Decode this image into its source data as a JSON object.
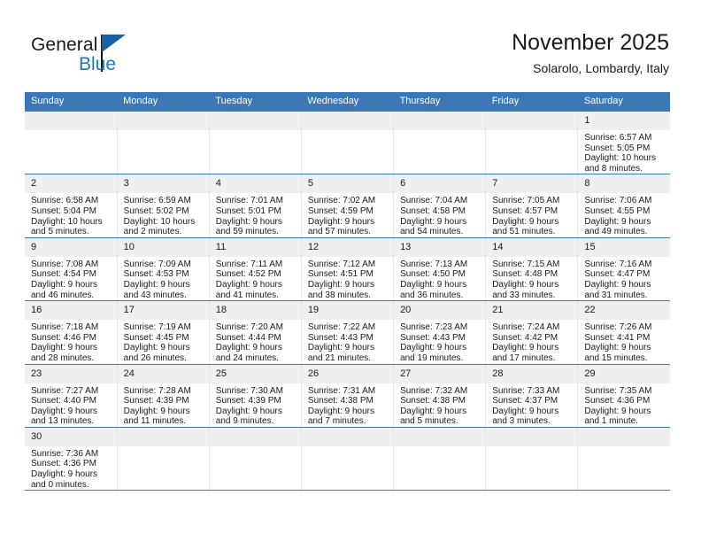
{
  "brand": {
    "name_top": "General",
    "name_bottom": "Blue",
    "triangle_color": "#1463a8",
    "blue_text_color": "#1878c8"
  },
  "header": {
    "title": "November 2025",
    "subtitle": "Solarolo, Lombardy, Italy"
  },
  "theme": {
    "header_blue": "#3b78b5",
    "daynum_bg": "#efefef",
    "row_divider": "#3b78b5"
  },
  "calendar": {
    "weekday_headers": [
      "Sunday",
      "Monday",
      "Tuesday",
      "Wednesday",
      "Thursday",
      "Friday",
      "Saturday"
    ],
    "labels": {
      "sunrise": "Sunrise:",
      "sunset": "Sunset:",
      "daylight": "Daylight:"
    },
    "weeks": [
      [
        {
          "day": "",
          "blank": true
        },
        {
          "day": "",
          "blank": true
        },
        {
          "day": "",
          "blank": true
        },
        {
          "day": "",
          "blank": true
        },
        {
          "day": "",
          "blank": true
        },
        {
          "day": "",
          "blank": true
        },
        {
          "day": "1",
          "sunrise": "Sunrise: 6:57 AM",
          "sunset": "Sunset: 5:05 PM",
          "daylight1": "Daylight: 10 hours",
          "daylight2": "and 8 minutes."
        }
      ],
      [
        {
          "day": "2",
          "sunrise": "Sunrise: 6:58 AM",
          "sunset": "Sunset: 5:04 PM",
          "daylight1": "Daylight: 10 hours",
          "daylight2": "and 5 minutes."
        },
        {
          "day": "3",
          "sunrise": "Sunrise: 6:59 AM",
          "sunset": "Sunset: 5:02 PM",
          "daylight1": "Daylight: 10 hours",
          "daylight2": "and 2 minutes."
        },
        {
          "day": "4",
          "sunrise": "Sunrise: 7:01 AM",
          "sunset": "Sunset: 5:01 PM",
          "daylight1": "Daylight: 9 hours",
          "daylight2": "and 59 minutes."
        },
        {
          "day": "5",
          "sunrise": "Sunrise: 7:02 AM",
          "sunset": "Sunset: 4:59 PM",
          "daylight1": "Daylight: 9 hours",
          "daylight2": "and 57 minutes."
        },
        {
          "day": "6",
          "sunrise": "Sunrise: 7:04 AM",
          "sunset": "Sunset: 4:58 PM",
          "daylight1": "Daylight: 9 hours",
          "daylight2": "and 54 minutes."
        },
        {
          "day": "7",
          "sunrise": "Sunrise: 7:05 AM",
          "sunset": "Sunset: 4:57 PM",
          "daylight1": "Daylight: 9 hours",
          "daylight2": "and 51 minutes."
        },
        {
          "day": "8",
          "sunrise": "Sunrise: 7:06 AM",
          "sunset": "Sunset: 4:55 PM",
          "daylight1": "Daylight: 9 hours",
          "daylight2": "and 49 minutes."
        }
      ],
      [
        {
          "day": "9",
          "sunrise": "Sunrise: 7:08 AM",
          "sunset": "Sunset: 4:54 PM",
          "daylight1": "Daylight: 9 hours",
          "daylight2": "and 46 minutes."
        },
        {
          "day": "10",
          "sunrise": "Sunrise: 7:09 AM",
          "sunset": "Sunset: 4:53 PM",
          "daylight1": "Daylight: 9 hours",
          "daylight2": "and 43 minutes."
        },
        {
          "day": "11",
          "sunrise": "Sunrise: 7:11 AM",
          "sunset": "Sunset: 4:52 PM",
          "daylight1": "Daylight: 9 hours",
          "daylight2": "and 41 minutes."
        },
        {
          "day": "12",
          "sunrise": "Sunrise: 7:12 AM",
          "sunset": "Sunset: 4:51 PM",
          "daylight1": "Daylight: 9 hours",
          "daylight2": "and 38 minutes."
        },
        {
          "day": "13",
          "sunrise": "Sunrise: 7:13 AM",
          "sunset": "Sunset: 4:50 PM",
          "daylight1": "Daylight: 9 hours",
          "daylight2": "and 36 minutes."
        },
        {
          "day": "14",
          "sunrise": "Sunrise: 7:15 AM",
          "sunset": "Sunset: 4:48 PM",
          "daylight1": "Daylight: 9 hours",
          "daylight2": "and 33 minutes."
        },
        {
          "day": "15",
          "sunrise": "Sunrise: 7:16 AM",
          "sunset": "Sunset: 4:47 PM",
          "daylight1": "Daylight: 9 hours",
          "daylight2": "and 31 minutes."
        }
      ],
      [
        {
          "day": "16",
          "sunrise": "Sunrise: 7:18 AM",
          "sunset": "Sunset: 4:46 PM",
          "daylight1": "Daylight: 9 hours",
          "daylight2": "and 28 minutes."
        },
        {
          "day": "17",
          "sunrise": "Sunrise: 7:19 AM",
          "sunset": "Sunset: 4:45 PM",
          "daylight1": "Daylight: 9 hours",
          "daylight2": "and 26 minutes."
        },
        {
          "day": "18",
          "sunrise": "Sunrise: 7:20 AM",
          "sunset": "Sunset: 4:44 PM",
          "daylight1": "Daylight: 9 hours",
          "daylight2": "and 24 minutes."
        },
        {
          "day": "19",
          "sunrise": "Sunrise: 7:22 AM",
          "sunset": "Sunset: 4:43 PM",
          "daylight1": "Daylight: 9 hours",
          "daylight2": "and 21 minutes."
        },
        {
          "day": "20",
          "sunrise": "Sunrise: 7:23 AM",
          "sunset": "Sunset: 4:43 PM",
          "daylight1": "Daylight: 9 hours",
          "daylight2": "and 19 minutes."
        },
        {
          "day": "21",
          "sunrise": "Sunrise: 7:24 AM",
          "sunset": "Sunset: 4:42 PM",
          "daylight1": "Daylight: 9 hours",
          "daylight2": "and 17 minutes."
        },
        {
          "day": "22",
          "sunrise": "Sunrise: 7:26 AM",
          "sunset": "Sunset: 4:41 PM",
          "daylight1": "Daylight: 9 hours",
          "daylight2": "and 15 minutes."
        }
      ],
      [
        {
          "day": "23",
          "sunrise": "Sunrise: 7:27 AM",
          "sunset": "Sunset: 4:40 PM",
          "daylight1": "Daylight: 9 hours",
          "daylight2": "and 13 minutes."
        },
        {
          "day": "24",
          "sunrise": "Sunrise: 7:28 AM",
          "sunset": "Sunset: 4:39 PM",
          "daylight1": "Daylight: 9 hours",
          "daylight2": "and 11 minutes."
        },
        {
          "day": "25",
          "sunrise": "Sunrise: 7:30 AM",
          "sunset": "Sunset: 4:39 PM",
          "daylight1": "Daylight: 9 hours",
          "daylight2": "and 9 minutes."
        },
        {
          "day": "26",
          "sunrise": "Sunrise: 7:31 AM",
          "sunset": "Sunset: 4:38 PM",
          "daylight1": "Daylight: 9 hours",
          "daylight2": "and 7 minutes."
        },
        {
          "day": "27",
          "sunrise": "Sunrise: 7:32 AM",
          "sunset": "Sunset: 4:38 PM",
          "daylight1": "Daylight: 9 hours",
          "daylight2": "and 5 minutes."
        },
        {
          "day": "28",
          "sunrise": "Sunrise: 7:33 AM",
          "sunset": "Sunset: 4:37 PM",
          "daylight1": "Daylight: 9 hours",
          "daylight2": "and 3 minutes."
        },
        {
          "day": "29",
          "sunrise": "Sunrise: 7:35 AM",
          "sunset": "Sunset: 4:36 PM",
          "daylight1": "Daylight: 9 hours",
          "daylight2": "and 1 minute."
        }
      ],
      [
        {
          "day": "30",
          "sunrise": "Sunrise: 7:36 AM",
          "sunset": "Sunset: 4:36 PM",
          "daylight1": "Daylight: 9 hours",
          "daylight2": "and 0 minutes."
        },
        {
          "day": "",
          "blank": true
        },
        {
          "day": "",
          "blank": true
        },
        {
          "day": "",
          "blank": true
        },
        {
          "day": "",
          "blank": true
        },
        {
          "day": "",
          "blank": true
        },
        {
          "day": "",
          "blank": true
        }
      ]
    ]
  }
}
